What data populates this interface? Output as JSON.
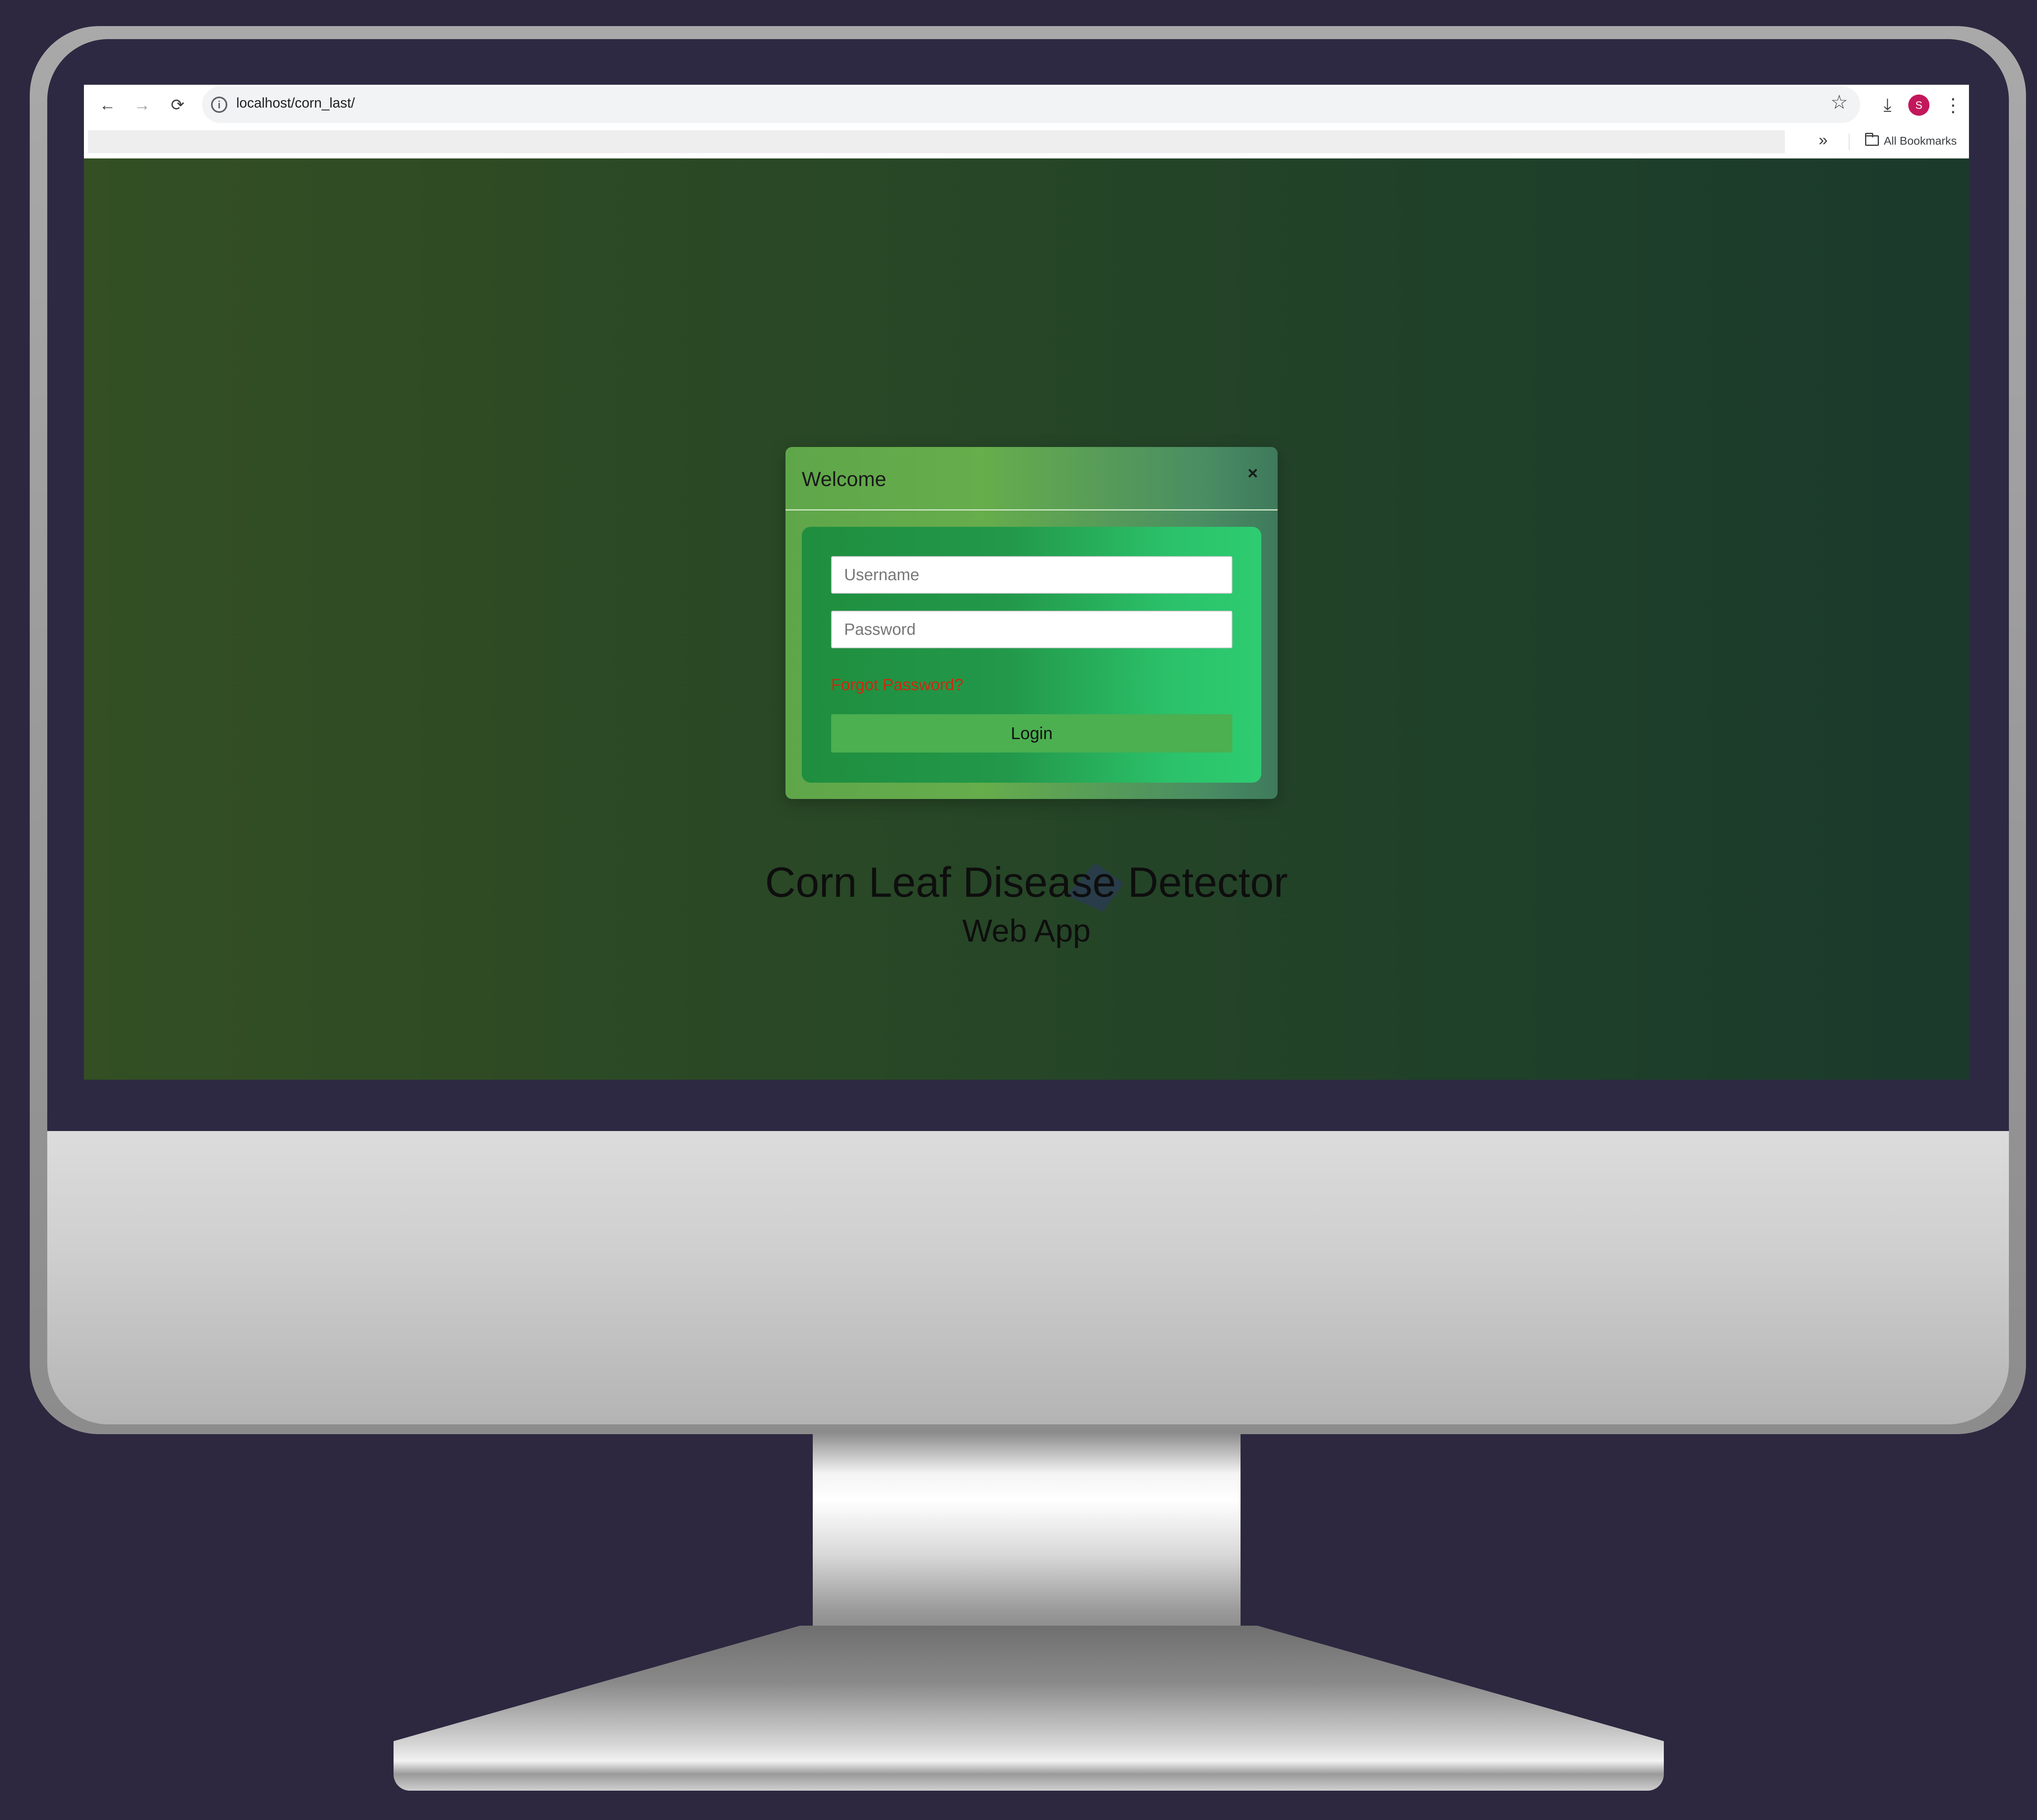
{
  "browser": {
    "url": "localhost/corn_last/",
    "nav": {
      "back": "←",
      "forward": "→",
      "reload": "⟳"
    },
    "info_glyph": "i",
    "star_glyph": "☆",
    "download_glyph": "⤓",
    "profile_initial": "S",
    "menu_glyph": "⋮",
    "bookmarks": {
      "overflow": "»",
      "all_label": "All Bookmarks"
    }
  },
  "modal": {
    "title": "Welcome",
    "close": "×",
    "username_placeholder": "Username",
    "password_placeholder": "Password",
    "forgot_password": "Forgot Password?",
    "login_label": "Login"
  },
  "app": {
    "title": "Corn Leaf Disease Detector",
    "subtitle": "Web App"
  },
  "colors": {
    "forgot_link": "#cc2a10",
    "login_button": "#4caf50",
    "profile_avatar": "#c2185b"
  },
  "icons": [
    "back-arrow-icon",
    "forward-arrow-icon",
    "reload-icon",
    "site-info-icon",
    "bookmark-star-icon",
    "download-icon",
    "more-menu-icon",
    "folder-icon",
    "gear-logo-icon",
    "close-icon"
  ]
}
